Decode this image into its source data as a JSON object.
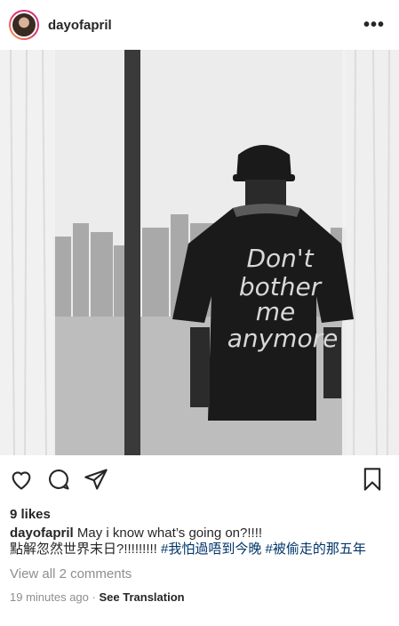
{
  "post": {
    "username": "dayofapril",
    "more_icon": "more-icon",
    "likes": "9 likes",
    "caption_user": "dayofapril",
    "caption_text_1": "May i know what’s going on?!!!!",
    "caption_text_2": "點解忽然世界末日?!!!!!!!!!",
    "hashtag_1": "#我怕過唔到今晚",
    "hashtag_2": "#被偷走的那五年",
    "view_comments": "View all 2 comments",
    "timestamp": "19 minutes ago",
    "separator": "·",
    "see_translation": "See Translation"
  },
  "shirt_text": [
    "Don't",
    "bother",
    "me",
    "anymore"
  ],
  "colors": {
    "hashtag": "#003569",
    "muted": "#8e8e8e",
    "text": "#262626"
  }
}
